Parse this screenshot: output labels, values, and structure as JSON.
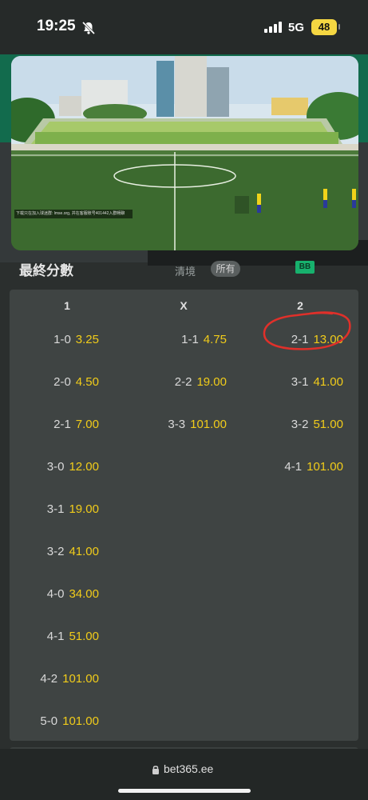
{
  "status_bar": {
    "time": "19:25",
    "network": "5G",
    "battery": "48"
  },
  "video": {
    "overlay_text": "下载只在加入球迷群: lmse.org, 并在客服账号401442入群畅聊"
  },
  "market": {
    "title": "最終分數",
    "filter_clear": "清境",
    "filter_all": "所有",
    "badge": "BB",
    "columns": [
      "1",
      "X",
      "2"
    ],
    "home": [
      {
        "score": "1-0",
        "price": "3.25"
      },
      {
        "score": "2-0",
        "price": "4.50"
      },
      {
        "score": "2-1",
        "price": "7.00"
      },
      {
        "score": "3-0",
        "price": "12.00"
      },
      {
        "score": "3-1",
        "price": "19.00"
      },
      {
        "score": "3-2",
        "price": "41.00"
      },
      {
        "score": "4-0",
        "price": "34.00"
      },
      {
        "score": "4-1",
        "price": "51.00"
      },
      {
        "score": "4-2",
        "price": "101.00"
      },
      {
        "score": "5-0",
        "price": "101.00"
      }
    ],
    "draw": [
      {
        "score": "1-1",
        "price": "4.75"
      },
      {
        "score": "2-2",
        "price": "19.00"
      },
      {
        "score": "3-3",
        "price": "101.00"
      }
    ],
    "away": [
      {
        "score": "2-1",
        "price": "13.00"
      },
      {
        "score": "3-1",
        "price": "41.00"
      },
      {
        "score": "3-2",
        "price": "51.00"
      },
      {
        "score": "4-1",
        "price": "101.00"
      }
    ],
    "highlight_color": "#e0302a"
  },
  "browser": {
    "url": "bet365.ee"
  },
  "colors": {
    "price": "#f1cc1a",
    "brand_green": "#126b4d",
    "badge_green": "#17b16d"
  }
}
